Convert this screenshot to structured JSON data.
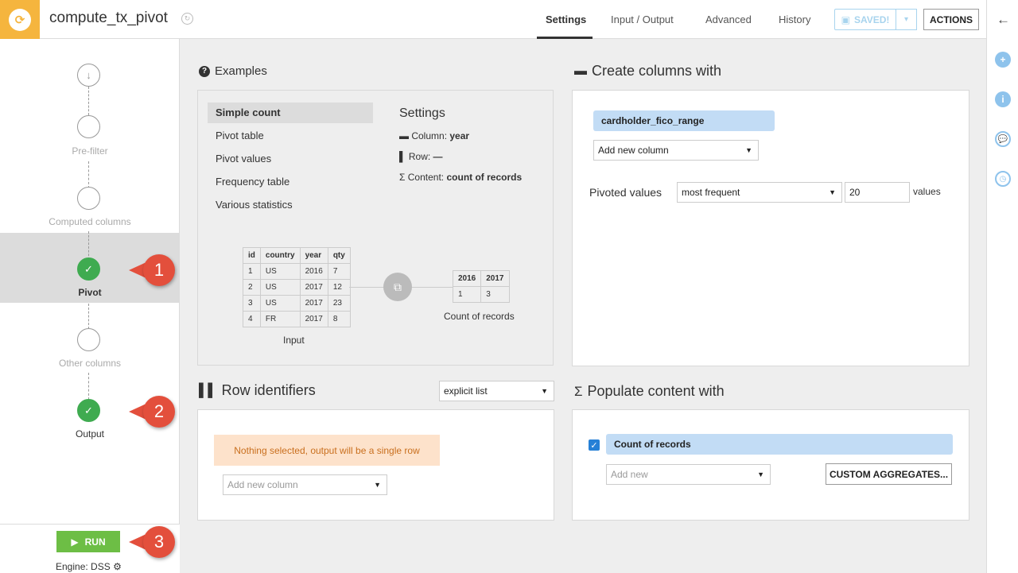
{
  "header": {
    "recipe_name": "compute_tx_pivot",
    "tabs": [
      "Settings",
      "Input / Output",
      "Advanced",
      "History"
    ],
    "active_tab": "Settings",
    "saved_label": "SAVED!",
    "actions_label": "ACTIONS"
  },
  "colors": {
    "brand": "#f5b53e",
    "success": "#3fab50",
    "run": "#6dbe45",
    "callout": "#e34f3c",
    "pill": "#c2dcf5",
    "warning_bg": "#fde2cb",
    "warning_text": "#c96f1e",
    "saved": "#a8d4ee"
  },
  "sidebar": {
    "steps": [
      {
        "label": "",
        "state": "start",
        "icon": "arrow-down-icon"
      },
      {
        "label": "Pre-filter",
        "state": "empty"
      },
      {
        "label": "Computed columns",
        "state": "empty"
      },
      {
        "label": "Pivot",
        "state": "done",
        "active": true
      },
      {
        "label": "Other columns",
        "state": "empty"
      },
      {
        "label": "Output",
        "state": "done"
      }
    ],
    "run_label": "RUN",
    "engine_label": "Engine: DSS"
  },
  "callouts": [
    "1",
    "2",
    "3"
  ],
  "examples": {
    "title": "Examples",
    "items": [
      "Simple count",
      "Pivot table",
      "Pivot values",
      "Frequency table",
      "Various statistics"
    ],
    "active": "Simple count",
    "settings_title": "Settings",
    "column_label": "Column:",
    "column_value": "year",
    "row_label": "Row:",
    "row_value": "—",
    "content_label": "Content:",
    "content_value": "count of records",
    "input_table": {
      "headers": [
        "id",
        "country",
        "year",
        "qty"
      ],
      "rows": [
        [
          "1",
          "US",
          "2016",
          "7"
        ],
        [
          "2",
          "US",
          "2017",
          "12"
        ],
        [
          "3",
          "US",
          "2017",
          "23"
        ],
        [
          "4",
          "FR",
          "2017",
          "8"
        ]
      ]
    },
    "output_table": {
      "headers": [
        "2016",
        "2017"
      ],
      "rows": [
        [
          "1",
          "3"
        ]
      ]
    },
    "input_caption": "Input",
    "output_caption": "Count of records"
  },
  "create_columns": {
    "title": "Create columns with",
    "column_pill": "cardholder_fico_range",
    "add_column_label": "Add new column",
    "pivoted_values_label": "Pivoted values",
    "pivoted_mode": "most frequent",
    "pivoted_count": "20",
    "values_suffix": "values"
  },
  "row_identifiers": {
    "title": "Row identifiers",
    "mode": "explicit list",
    "empty_message": "Nothing selected, output will be a single row",
    "add_column_placeholder": "Add new column"
  },
  "populate": {
    "title": "Populate content with",
    "aggregate_label": "Count of records",
    "aggregate_checked": true,
    "add_new_placeholder": "Add new",
    "custom_aggregates_label": "CUSTOM AGGREGATES..."
  }
}
